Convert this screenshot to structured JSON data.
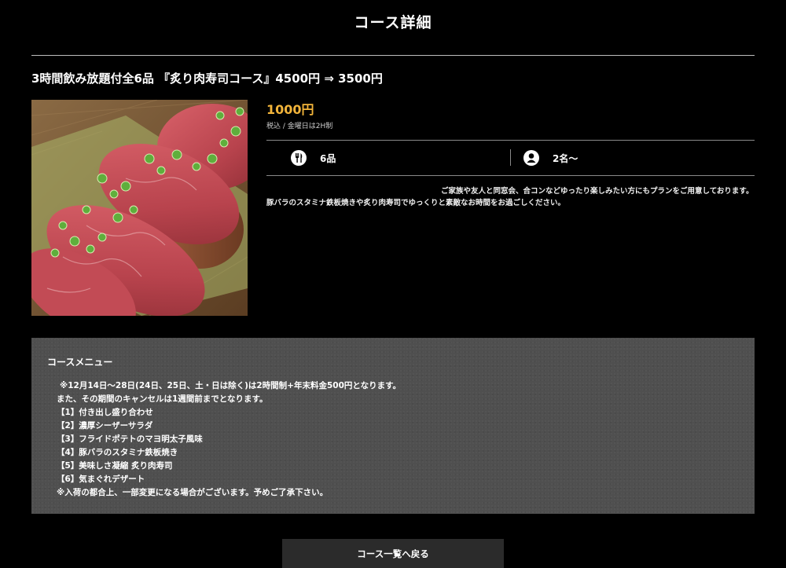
{
  "page": {
    "title": "コース詳細"
  },
  "course": {
    "title": "3時間飲み放題付全6品 『炙り肉寿司コース』4500円 ⇒ 3500円",
    "price": "1000円",
    "price_note": "税込 / 金曜日は2H制",
    "items": {
      "icon": "fork-knife-icon",
      "text": "6品"
    },
    "people": {
      "icon": "person-icon",
      "text": "2名～"
    },
    "description": "ご家族や友人と同窓会、合コンなどゆったり楽しみたい方にもプランをご用意しております。豚バラのスタミナ鉄板焼きや炙り肉寿司でゆっくりと素敵なお時間をお過ごしください。",
    "accent_color": "#f2b43a"
  },
  "menu": {
    "heading": "コースメニュー",
    "lines": [
      "※12月14日～28日(24日、25日、土・日は除く)は2時間制+年末料金500円となります。",
      "また、その期間のキャンセルは1週間前までとなります。",
      "【1】付き出し盛り合わせ",
      "【2】濃厚シーザーサラダ",
      "【3】フライドポテトのマヨ明太子風味",
      "【4】豚バラのスタミナ鉄板焼き",
      "【5】美味しさ凝縮 炙り肉寿司",
      "【6】気まぐれデザート",
      "※入荷の都合上、一部変更になる場合がございます。予めご了承下さい。"
    ]
  },
  "back_button": {
    "label": "コース一覧へ戻る"
  }
}
